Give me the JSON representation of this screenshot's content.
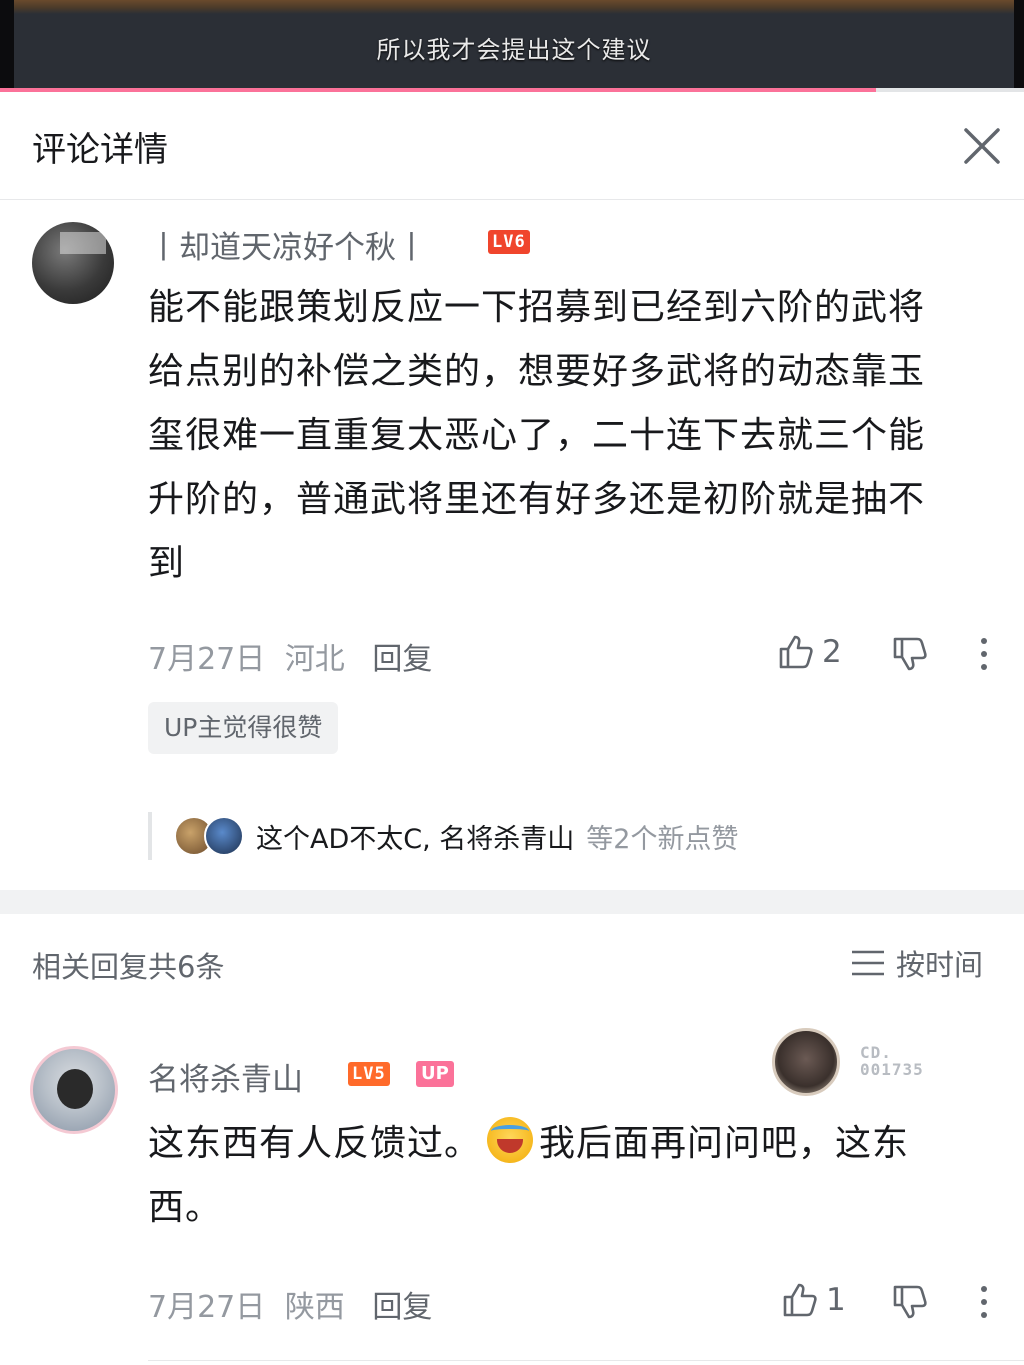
{
  "video": {
    "subtitle": "所以我才会提出这个建议",
    "progress_percent": 85.5
  },
  "header": {
    "title": "评论详情"
  },
  "main_comment": {
    "username": "丨却道天凉好个秋丨",
    "level": "LV6",
    "lines": [
      "能不能跟策划反应一下招募到已经到六阶的武将",
      "给点别的补偿之类的，想要好多武将的动态靠玉",
      "玺很难一直重复太恶心了，二十连下去就三个能",
      "升阶的，普通武将里还有好多还是初阶就是抽不",
      "到"
    ],
    "date": "7月27日",
    "location": "河北",
    "reply_label": "回复",
    "like_count": "2",
    "up_liked": "UP主觉得很赞",
    "likers_names": "这个AD不太C, 名将杀青山",
    "likers_extra": "等2个新点赞"
  },
  "replies": {
    "count_label": "相关回复共6条",
    "sort_label": "按时间"
  },
  "reply_1": {
    "username": "名将杀青山",
    "level": "LV5",
    "up_badge": "UP",
    "fan_no_line1": "CD.",
    "fan_no_line2": "001735",
    "text_part1": "这东西有人反馈过。",
    "text_part2": "我后面再问问吧，这东",
    "text_line2": "西。",
    "date": "7月27日",
    "location": "陕西",
    "reply_label": "回复",
    "like_count": "1"
  },
  "colors": {
    "accent_pink": "#fb7299",
    "level6_red": "#f0452c",
    "level5_orange": "#ff6a2a",
    "text_primary": "#18191c",
    "text_secondary": "#61666d",
    "text_muted": "#9499a0"
  },
  "icons": {
    "close": "close-icon",
    "like": "thumbs-up-icon",
    "dislike": "thumbs-down-icon",
    "more": "more-vertical-icon",
    "sort": "sort-lines-icon"
  }
}
